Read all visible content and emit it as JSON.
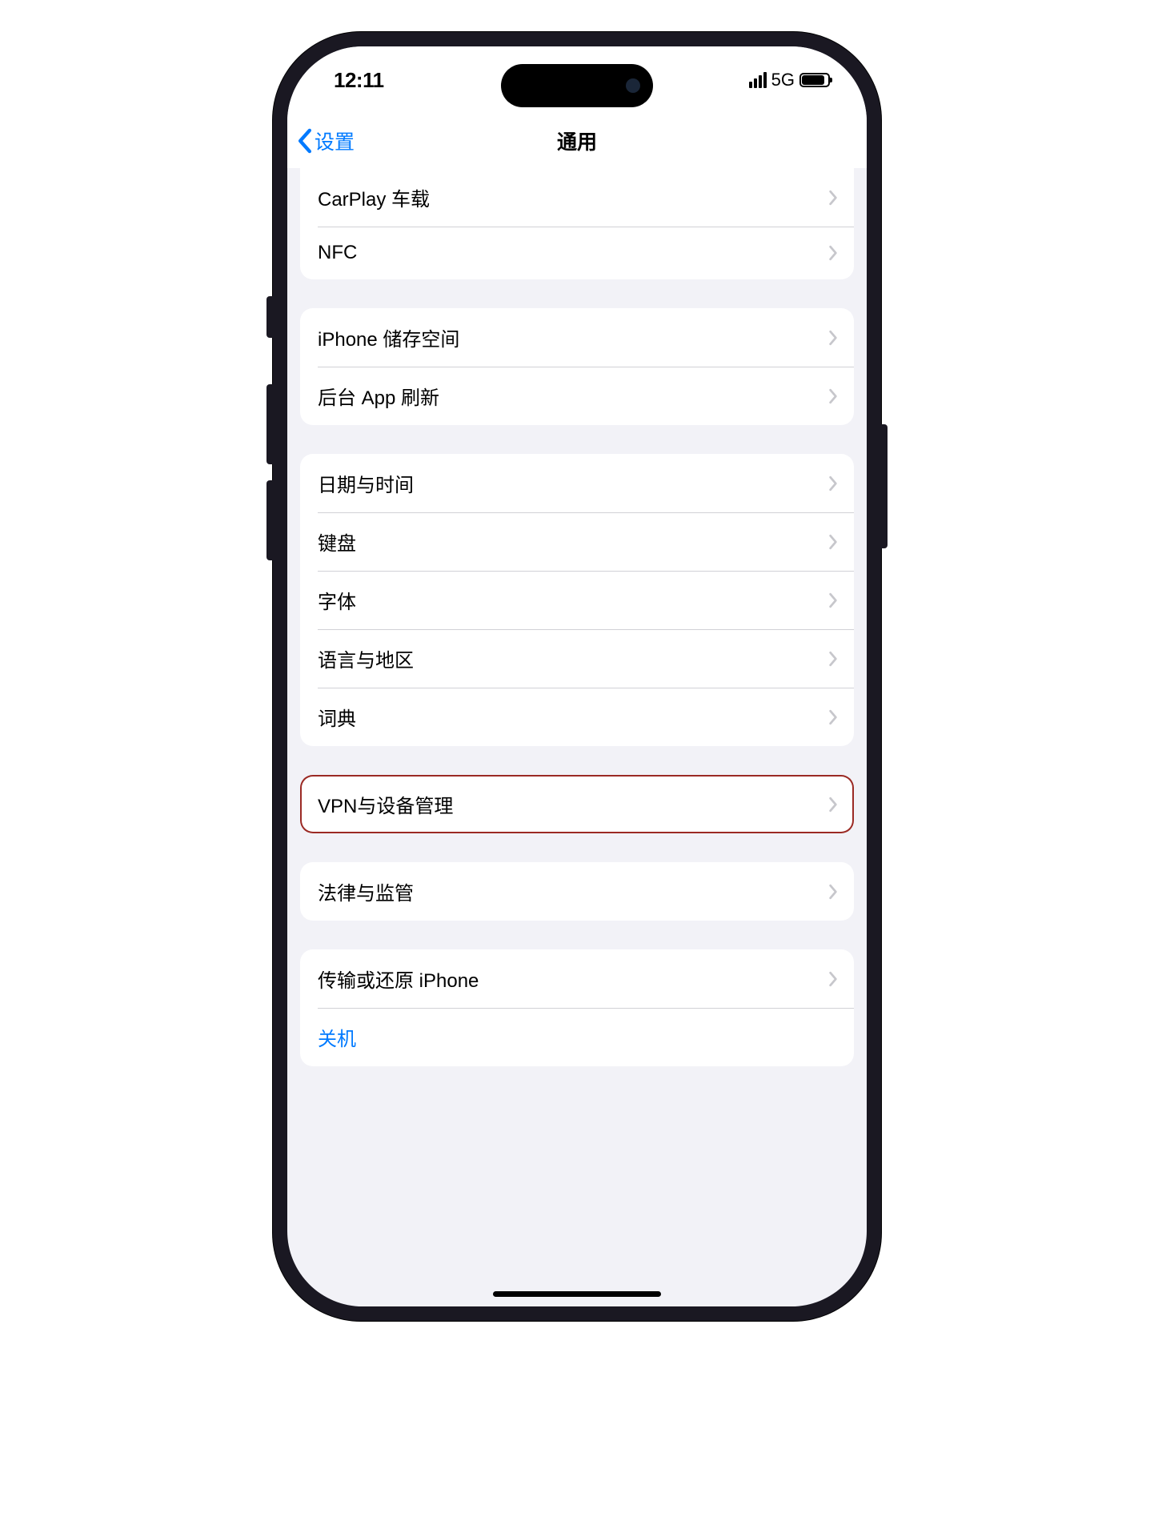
{
  "status": {
    "time": "12:11",
    "network": "5G"
  },
  "nav": {
    "back_label": "设置",
    "title": "通用"
  },
  "groups": [
    {
      "rows": [
        {
          "label": "CarPlay 车载",
          "chevron": true
        },
        {
          "label": "NFC",
          "chevron": true
        }
      ]
    },
    {
      "rows": [
        {
          "label": "iPhone 储存空间",
          "chevron": true
        },
        {
          "label": "后台 App 刷新",
          "chevron": true
        }
      ]
    },
    {
      "rows": [
        {
          "label": "日期与时间",
          "chevron": true
        },
        {
          "label": "键盘",
          "chevron": true
        },
        {
          "label": "字体",
          "chevron": true
        },
        {
          "label": "语言与地区",
          "chevron": true
        },
        {
          "label": "词典",
          "chevron": true
        }
      ]
    },
    {
      "highlighted": true,
      "rows": [
        {
          "label": "VPN与设备管理",
          "chevron": true
        }
      ]
    },
    {
      "rows": [
        {
          "label": "法律与监管",
          "chevron": true
        }
      ]
    },
    {
      "rows": [
        {
          "label": "传输或还原 iPhone",
          "chevron": true
        },
        {
          "label": "关机",
          "chevron": false,
          "accent": true
        }
      ]
    }
  ]
}
